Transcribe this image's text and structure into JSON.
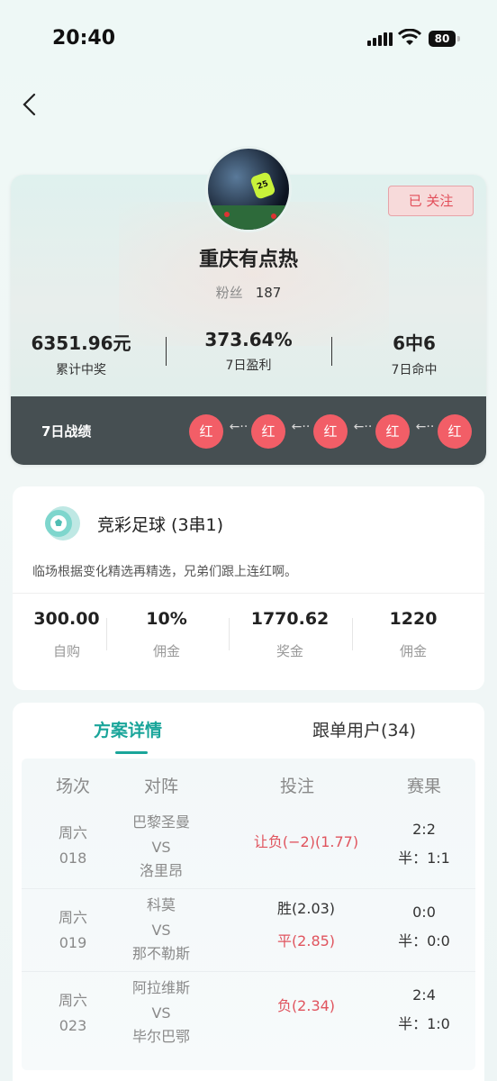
{
  "status_bar": {
    "time": "20:40",
    "battery": "80"
  },
  "profile": {
    "nickname": "重庆有点热",
    "fans_label": "粉丝",
    "fans_count": "187",
    "follow_label": "已 关注",
    "avatar_jersey": "25",
    "stats": [
      {
        "value": "6351.96元",
        "label": "累计中奖"
      },
      {
        "value": "373.64%",
        "label": "7日盈利"
      },
      {
        "value": "6中6",
        "label": "7日命中"
      }
    ],
    "record_title": "7日战绩",
    "record_badges": [
      "红",
      "红",
      "红",
      "红",
      "红"
    ],
    "record_arrow": "←··"
  },
  "plan": {
    "title": "竞彩足球 (3串1)",
    "description": "临场根据变化精选再精选，兄弟们跟上连红啊。",
    "stats": [
      {
        "value": "300.00",
        "label": "自购"
      },
      {
        "value": "10%",
        "label": "佣金"
      },
      {
        "value": "1770.62",
        "label": "奖金"
      },
      {
        "value": "1220",
        "label": "佣金"
      }
    ]
  },
  "tabs": [
    {
      "label": "方案详情",
      "active": true
    },
    {
      "label": "跟单用户(34)",
      "active": false
    }
  ],
  "table": {
    "headers": [
      "场次",
      "对阵",
      "投注",
      "赛果"
    ],
    "rows": [
      {
        "day": "周六",
        "num": "018",
        "home": "巴黎圣曼",
        "vs": "VS",
        "away": "洛里昂",
        "bets": [
          {
            "text": "让负(−2)(1.77)",
            "red": true
          }
        ],
        "score": "2:2",
        "half": "半：1:1"
      },
      {
        "day": "周六",
        "num": "019",
        "home": "科莫",
        "vs": "VS",
        "away": "那不勒斯",
        "bets": [
          {
            "text": "胜(2.03)",
            "red": false
          },
          {
            "text": "平(2.85)",
            "red": true
          }
        ],
        "score": "0:0",
        "half": "半：0:0"
      },
      {
        "day": "周六",
        "num": "023",
        "home": "阿拉维斯",
        "vs": "VS",
        "away": "毕尔巴鄂",
        "bets": [
          {
            "text": "负(2.34)",
            "red": true
          }
        ],
        "score": "2:4",
        "half": "半：1:0"
      }
    ]
  },
  "colors": {
    "accent": "#1aa59a",
    "red": "#f25e67",
    "dark_bar": "#464f52"
  }
}
